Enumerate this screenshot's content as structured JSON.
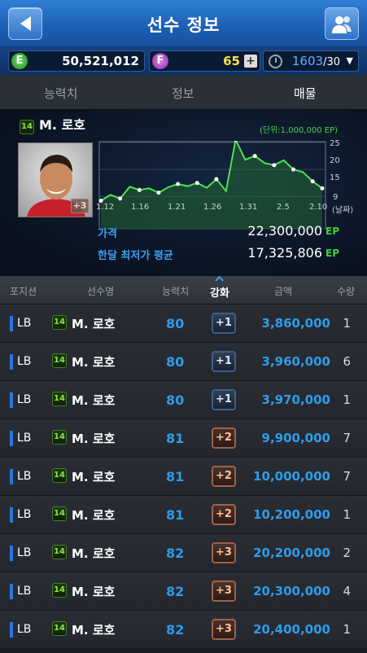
{
  "header": {
    "title": "선수 정보"
  },
  "currency": {
    "e_icon": "E",
    "e_value": "50,521,012",
    "f_icon": "F",
    "f_value": "65",
    "f_plus": "+",
    "time_value": "1603",
    "time_max": "/30"
  },
  "tabs": [
    {
      "label": "능력치"
    },
    {
      "label": "정보"
    },
    {
      "label": "매물"
    }
  ],
  "player": {
    "badge": "14",
    "name": "M. 로호",
    "enhance_tag": "+3"
  },
  "chart_data": {
    "type": "line",
    "unit": "(단위:1,000,000 EP)",
    "x": [
      "1.12",
      "1.16",
      "1.21",
      "1.26",
      "1.31",
      "2.5",
      "2.10"
    ],
    "x_suffix": "(날짜)",
    "y_ticks": [
      "25",
      "20",
      "15",
      "9"
    ],
    "ylim": [
      9,
      25
    ],
    "series": [
      {
        "values": [
          14.2,
          15.3,
          14.6,
          16.8,
          16.2,
          16.5,
          15.7,
          16.7,
          17.3,
          16.9,
          17.5,
          16.6,
          18.2,
          16.0,
          25.5,
          21.8,
          22.5,
          21.2,
          20.8,
          21.7,
          20.0,
          19.5,
          17.8,
          16.5
        ]
      }
    ]
  },
  "price": {
    "label": "가격",
    "value": "22,300,000",
    "unit": "EP",
    "avg_label": "한달 최저가 평균",
    "avg_value": "17,325,806",
    "avg_unit": "EP"
  },
  "table": {
    "headers": {
      "pos": "포지션",
      "name": "선수명",
      "rating": "능력치",
      "enh": "강화",
      "amount": "금액",
      "qty": "수량"
    },
    "rows": [
      {
        "pos": "LB",
        "badge": "14",
        "name": "M. 로호",
        "rating": "80",
        "enh": "+1",
        "amount": "3,860,000",
        "qty": "1"
      },
      {
        "pos": "LB",
        "badge": "14",
        "name": "M. 로호",
        "rating": "80",
        "enh": "+1",
        "amount": "3,960,000",
        "qty": "6"
      },
      {
        "pos": "LB",
        "badge": "14",
        "name": "M. 로호",
        "rating": "80",
        "enh": "+1",
        "amount": "3,970,000",
        "qty": "1"
      },
      {
        "pos": "LB",
        "badge": "14",
        "name": "M. 로호",
        "rating": "81",
        "enh": "+2",
        "amount": "9,900,000",
        "qty": "7"
      },
      {
        "pos": "LB",
        "badge": "14",
        "name": "M. 로호",
        "rating": "81",
        "enh": "+2",
        "amount": "10,000,000",
        "qty": "7"
      },
      {
        "pos": "LB",
        "badge": "14",
        "name": "M. 로호",
        "rating": "81",
        "enh": "+2",
        "amount": "10,200,000",
        "qty": "1"
      },
      {
        "pos": "LB",
        "badge": "14",
        "name": "M. 로호",
        "rating": "82",
        "enh": "+3",
        "amount": "20,200,000",
        "qty": "2"
      },
      {
        "pos": "LB",
        "badge": "14",
        "name": "M. 로호",
        "rating": "82",
        "enh": "+3",
        "amount": "20,300,000",
        "qty": "4"
      },
      {
        "pos": "LB",
        "badge": "14",
        "name": "M. 로호",
        "rating": "82",
        "enh": "+3",
        "amount": "20,400,000",
        "qty": "1"
      }
    ]
  }
}
